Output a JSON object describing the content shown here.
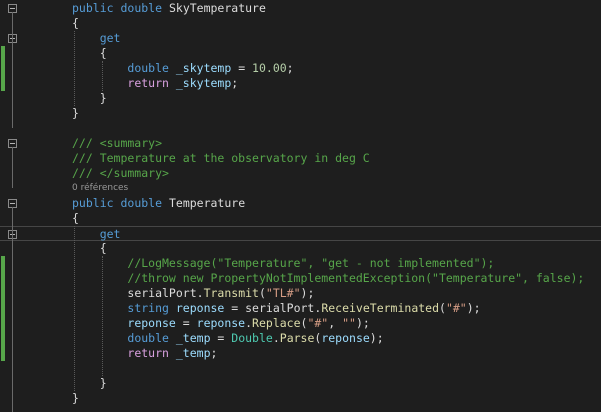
{
  "colors": {
    "background": "#1e1e1e",
    "keyword": "#569cd6",
    "control": "#d8a0df",
    "identifier": "#9cdcfe",
    "type": "#4ec9b0",
    "method": "#dcdcaa",
    "string": "#d69d85",
    "number": "#b5cea8",
    "comment": "#57a64a",
    "plain": "#dcdcdc",
    "codelens": "#999999",
    "change_marker": "#57a64a"
  },
  "editor": {
    "lines": [
      {
        "kind": "code",
        "fold": true,
        "tokens": [
          {
            "t": "keyword",
            "v": "public"
          },
          {
            "t": "plain",
            "v": " "
          },
          {
            "t": "keyword",
            "v": "double"
          },
          {
            "t": "plain",
            "v": " "
          },
          {
            "t": "plain",
            "v": "SkyTemperature"
          }
        ]
      },
      {
        "kind": "code",
        "tokens": [
          {
            "t": "punct",
            "v": "{"
          }
        ]
      },
      {
        "kind": "code",
        "fold": true,
        "tokens": [
          {
            "t": "plain",
            "v": "    "
          },
          {
            "t": "keyword",
            "v": "get"
          }
        ]
      },
      {
        "kind": "code",
        "changed": true,
        "tokens": [
          {
            "t": "plain",
            "v": "    "
          },
          {
            "t": "punct",
            "v": "{"
          }
        ]
      },
      {
        "kind": "code",
        "changed": true,
        "tokens": [
          {
            "t": "plain",
            "v": "        "
          },
          {
            "t": "keyword",
            "v": "double"
          },
          {
            "t": "plain",
            "v": " "
          },
          {
            "t": "ident",
            "v": "_skytemp"
          },
          {
            "t": "plain",
            "v": " = "
          },
          {
            "t": "number",
            "v": "10.00"
          },
          {
            "t": "punct",
            "v": ";"
          }
        ]
      },
      {
        "kind": "code",
        "changed": true,
        "tokens": [
          {
            "t": "plain",
            "v": "        "
          },
          {
            "t": "control",
            "v": "return"
          },
          {
            "t": "plain",
            "v": " "
          },
          {
            "t": "ident",
            "v": "_skytemp"
          },
          {
            "t": "punct",
            "v": ";"
          }
        ]
      },
      {
        "kind": "code",
        "tokens": [
          {
            "t": "plain",
            "v": "    "
          },
          {
            "t": "punct",
            "v": "}"
          }
        ]
      },
      {
        "kind": "code",
        "tokens": [
          {
            "t": "punct",
            "v": "}"
          }
        ]
      },
      {
        "kind": "blank",
        "tokens": []
      },
      {
        "kind": "code",
        "fold": true,
        "tokens": [
          {
            "t": "comment",
            "v": "/// <summary>"
          }
        ]
      },
      {
        "kind": "code",
        "tokens": [
          {
            "t": "comment",
            "v": "/// Temperature at the observatory in deg C"
          }
        ]
      },
      {
        "kind": "code",
        "tokens": [
          {
            "t": "comment",
            "v": "/// </summary>"
          }
        ]
      },
      {
        "kind": "codelens",
        "text": "0 références"
      },
      {
        "kind": "code",
        "fold": true,
        "tokens": [
          {
            "t": "keyword",
            "v": "public"
          },
          {
            "t": "plain",
            "v": " "
          },
          {
            "t": "keyword",
            "v": "double"
          },
          {
            "t": "plain",
            "v": " "
          },
          {
            "t": "plain",
            "v": "Temperature"
          }
        ]
      },
      {
        "kind": "code",
        "tokens": [
          {
            "t": "punct",
            "v": "{"
          }
        ]
      },
      {
        "kind": "code",
        "fold": true,
        "current": true,
        "tokens": [
          {
            "t": "plain",
            "v": "    "
          },
          {
            "t": "keyword",
            "v": "get"
          }
        ]
      },
      {
        "kind": "code",
        "tokens": [
          {
            "t": "plain",
            "v": "    "
          },
          {
            "t": "punct",
            "v": "{"
          }
        ]
      },
      {
        "kind": "code",
        "changed": true,
        "tokens": [
          {
            "t": "plain",
            "v": "        "
          },
          {
            "t": "comment",
            "v": "//LogMessage(\"Temperature\", \"get - not implemented\");"
          }
        ]
      },
      {
        "kind": "code",
        "changed": true,
        "tokens": [
          {
            "t": "plain",
            "v": "        "
          },
          {
            "t": "comment",
            "v": "//throw new PropertyNotImplementedException(\"Temperature\", false);"
          }
        ]
      },
      {
        "kind": "code",
        "changed": true,
        "tokens": [
          {
            "t": "plain",
            "v": "        "
          },
          {
            "t": "plain",
            "v": "serialPort"
          },
          {
            "t": "punct",
            "v": "."
          },
          {
            "t": "method",
            "v": "Transmit"
          },
          {
            "t": "punct",
            "v": "("
          },
          {
            "t": "string",
            "v": "\"TL#\""
          },
          {
            "t": "punct",
            "v": ");"
          }
        ]
      },
      {
        "kind": "code",
        "changed": true,
        "tokens": [
          {
            "t": "plain",
            "v": "        "
          },
          {
            "t": "keyword",
            "v": "string"
          },
          {
            "t": "plain",
            "v": " "
          },
          {
            "t": "ident",
            "v": "reponse"
          },
          {
            "t": "plain",
            "v": " = "
          },
          {
            "t": "plain",
            "v": "serialPort"
          },
          {
            "t": "punct",
            "v": "."
          },
          {
            "t": "method",
            "v": "ReceiveTerminated"
          },
          {
            "t": "punct",
            "v": "("
          },
          {
            "t": "string",
            "v": "\"#\""
          },
          {
            "t": "punct",
            "v": ");"
          }
        ]
      },
      {
        "kind": "code",
        "changed": true,
        "tokens": [
          {
            "t": "plain",
            "v": "        "
          },
          {
            "t": "ident",
            "v": "reponse"
          },
          {
            "t": "plain",
            "v": " = "
          },
          {
            "t": "ident",
            "v": "reponse"
          },
          {
            "t": "punct",
            "v": "."
          },
          {
            "t": "method",
            "v": "Replace"
          },
          {
            "t": "punct",
            "v": "("
          },
          {
            "t": "string",
            "v": "\"#\""
          },
          {
            "t": "punct",
            "v": ", "
          },
          {
            "t": "string",
            "v": "\"\""
          },
          {
            "t": "punct",
            "v": ");"
          }
        ]
      },
      {
        "kind": "code",
        "changed": true,
        "tokens": [
          {
            "t": "plain",
            "v": "        "
          },
          {
            "t": "keyword",
            "v": "double"
          },
          {
            "t": "plain",
            "v": " "
          },
          {
            "t": "ident",
            "v": "_temp"
          },
          {
            "t": "plain",
            "v": " = "
          },
          {
            "t": "type",
            "v": "Double"
          },
          {
            "t": "punct",
            "v": "."
          },
          {
            "t": "method",
            "v": "Parse"
          },
          {
            "t": "punct",
            "v": "("
          },
          {
            "t": "ident",
            "v": "reponse"
          },
          {
            "t": "punct",
            "v": ");"
          }
        ]
      },
      {
        "kind": "code",
        "changed": true,
        "tokens": [
          {
            "t": "plain",
            "v": "        "
          },
          {
            "t": "control",
            "v": "return"
          },
          {
            "t": "plain",
            "v": " "
          },
          {
            "t": "ident",
            "v": "_temp"
          },
          {
            "t": "punct",
            "v": ";"
          }
        ]
      },
      {
        "kind": "blank",
        "tokens": []
      },
      {
        "kind": "code",
        "tokens": [
          {
            "t": "plain",
            "v": "    "
          },
          {
            "t": "punct",
            "v": "}"
          }
        ]
      },
      {
        "kind": "code",
        "tokens": [
          {
            "t": "punct",
            "v": "}"
          }
        ]
      }
    ]
  }
}
